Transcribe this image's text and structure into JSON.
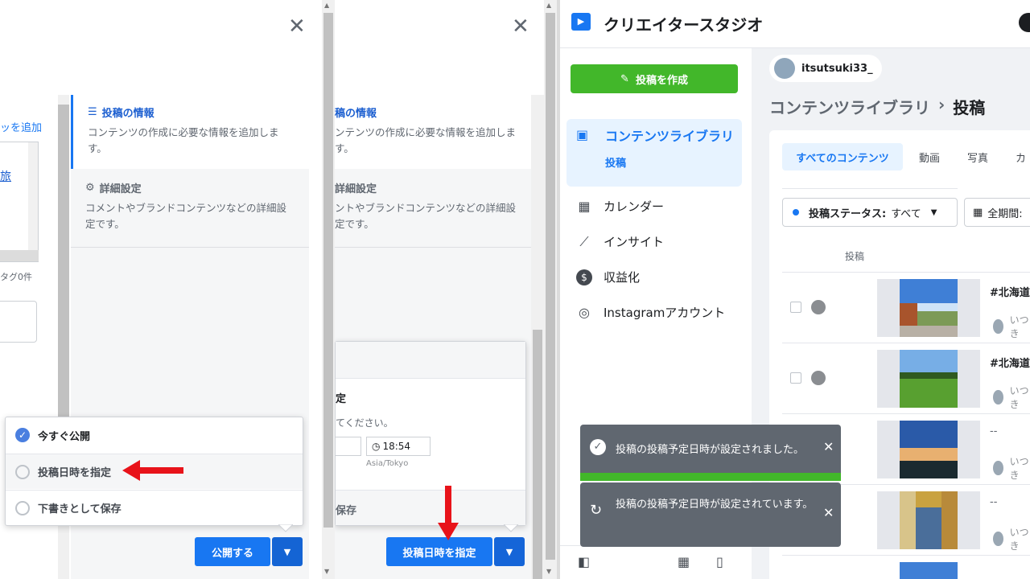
{
  "panel1": {
    "add_link": "ッを追加",
    "partial_text": "旅",
    "tag_count": "タグ0件",
    "info": {
      "title": "投稿の情報",
      "desc": "コンテンツの作成に必要な情報を追加します。"
    },
    "advanced": {
      "title": "詳細設定",
      "desc": "コメントやブランドコンテンツなどの詳細設定です。"
    },
    "dropdown": {
      "options": [
        "今すぐ公開",
        "投稿日時を指定",
        "下書きとして保存"
      ]
    },
    "publish_button": "公開する"
  },
  "panel2": {
    "info": {
      "title": "稿の情報",
      "desc": "ンテンツの作成に必要な情報を追加します。"
    },
    "advanced": {
      "title": "詳細設定",
      "desc": "ントやブランドコンテンツなどの詳細設定です。"
    },
    "popover": {
      "heading_partial": "定",
      "instruction_partial": "てください。",
      "time": "18:54",
      "timezone": "Asia/Tokyo",
      "save_partial": "保存"
    },
    "schedule_button": "投稿日時を指定"
  },
  "panel3": {
    "app_title": "クリエイタースタジオ",
    "create_button": "投稿を作成",
    "nav": {
      "content_library": "コンテンツライブラリ",
      "sub_posts": "投稿",
      "calendar": "カレンダー",
      "insights": "インサイト",
      "monetization": "収益化",
      "instagram": "Instagramアカウント"
    },
    "account_name": "itsutsuki33_",
    "breadcrumb": {
      "parent": "コンテンツライブラリ",
      "separator": "›",
      "current": "投稿"
    },
    "tabs": [
      "すべてのコンテンツ",
      "動画",
      "写真",
      "カ"
    ],
    "filters": {
      "status_label": "投稿ステータス:",
      "status_value": "すべて",
      "period": "全期間:"
    },
    "column_header": "投稿",
    "rows": [
      {
        "title": "#北海道 #hokk",
        "author": "いつき"
      },
      {
        "title": "#北海道",
        "author": "いつき"
      },
      {
        "title": "--",
        "author": "いつき"
      },
      {
        "title": "--",
        "author": "いつき"
      }
    ],
    "toasts": [
      "投稿の投稿予定日時が設定されました。",
      "投稿の投稿予定日時が設定されています。"
    ]
  },
  "colors": {
    "brand_blue": "#1877f2",
    "green": "#42b72a",
    "toast_gray": "#606770",
    "red": "#e8131a"
  }
}
